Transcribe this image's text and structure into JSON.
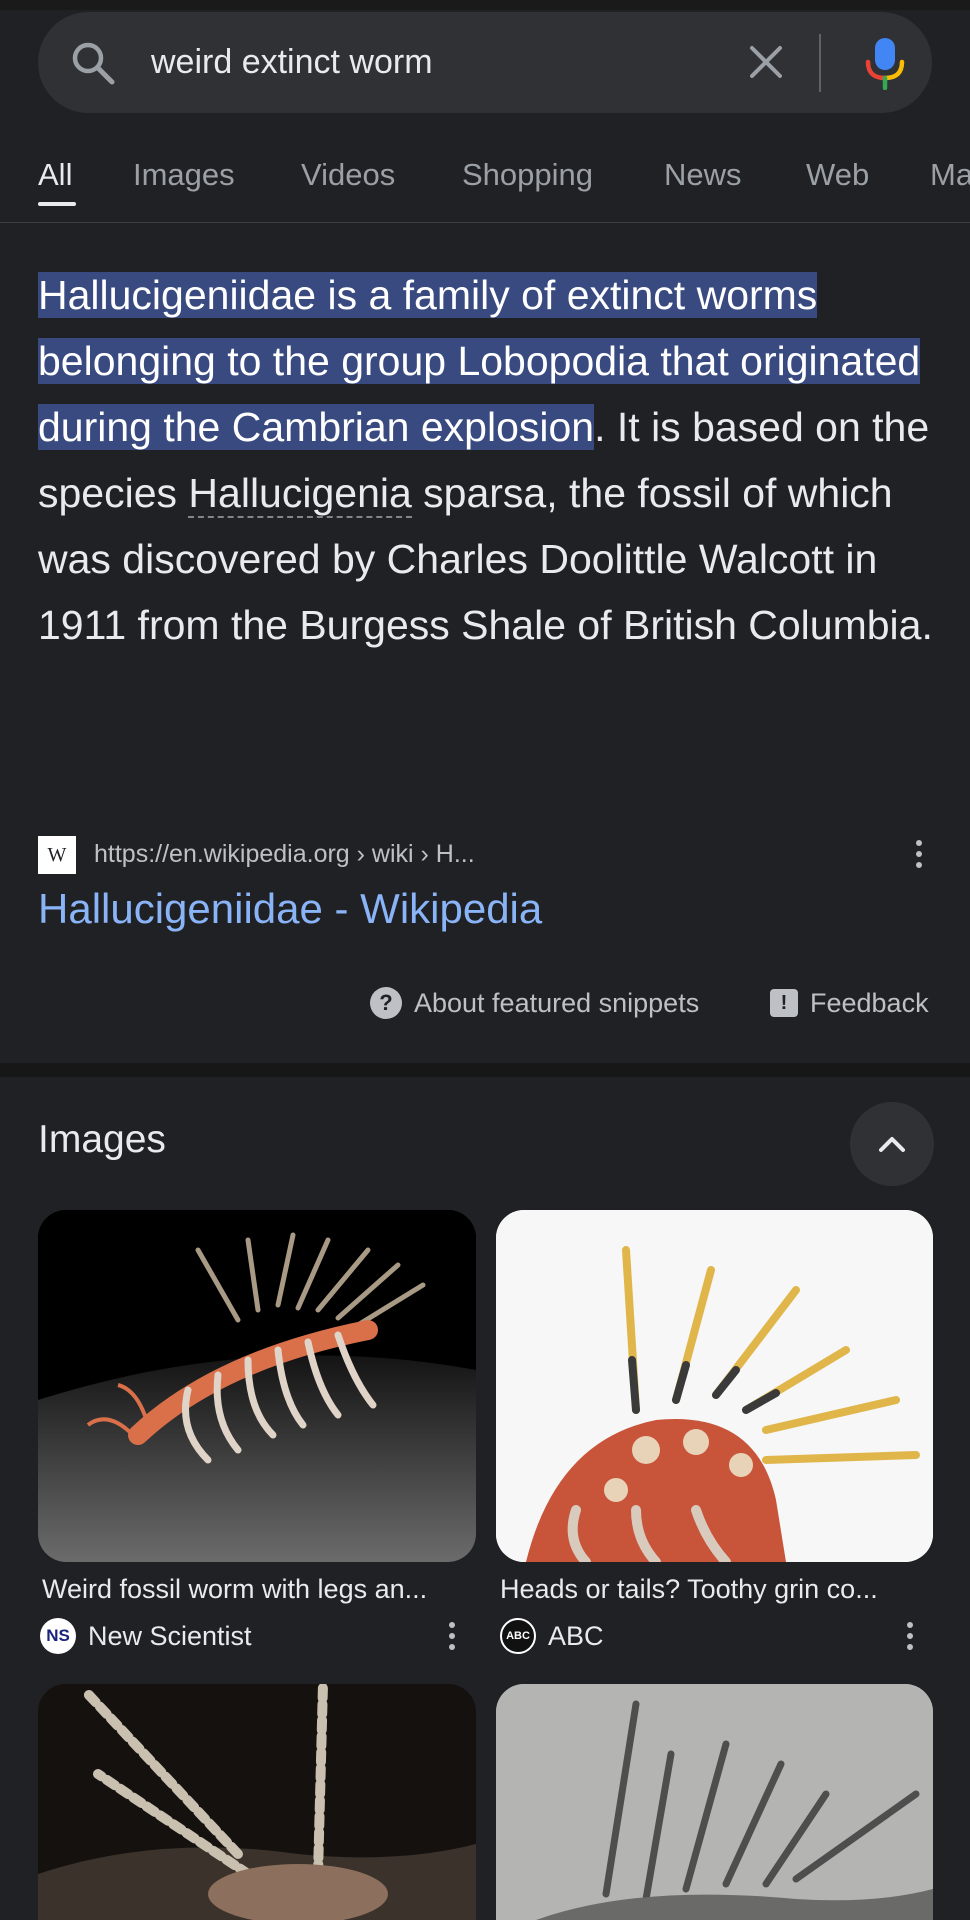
{
  "search": {
    "query": "weird extinct worm",
    "icons": [
      "search-icon",
      "clear-icon",
      "mic-icon"
    ]
  },
  "tabs": [
    {
      "label": "All",
      "active": true
    },
    {
      "label": "Images"
    },
    {
      "label": "Videos"
    },
    {
      "label": "Shopping"
    },
    {
      "label": "News"
    },
    {
      "label": "Web"
    },
    {
      "label": "Ma"
    }
  ],
  "snippet": {
    "highlighted": "Hallucigeniidae is a family of extinct worms belonging to the group Lobopodia that originated during the Cambrian explosion",
    "rest_1": ". It is based on the species ",
    "link_term": "Hallucigenia",
    "rest_2": " sparsa, the fossil of which was discovered by Charles Doolittle Walcott in 1911 from the Burgess Shale of British Columbia."
  },
  "source": {
    "favicon_letter": "W",
    "url": "https://en.wikipedia.org › wiki › H...",
    "title": "Hallucigeniidae - Wikipedia"
  },
  "meta": {
    "about": "About featured snippets",
    "feedback": "Feedback"
  },
  "images_section": {
    "heading": "Images",
    "cards": [
      {
        "caption": "Weird fossil worm with legs an...",
        "site": "New Scientist",
        "logo": "NS"
      },
      {
        "caption": "Heads or tails? Toothy grin co...",
        "site": "ABC",
        "logo": "ABC"
      }
    ]
  },
  "colors": {
    "background": "#202124",
    "link": "#8ab4f8",
    "highlight": "#394a80"
  }
}
